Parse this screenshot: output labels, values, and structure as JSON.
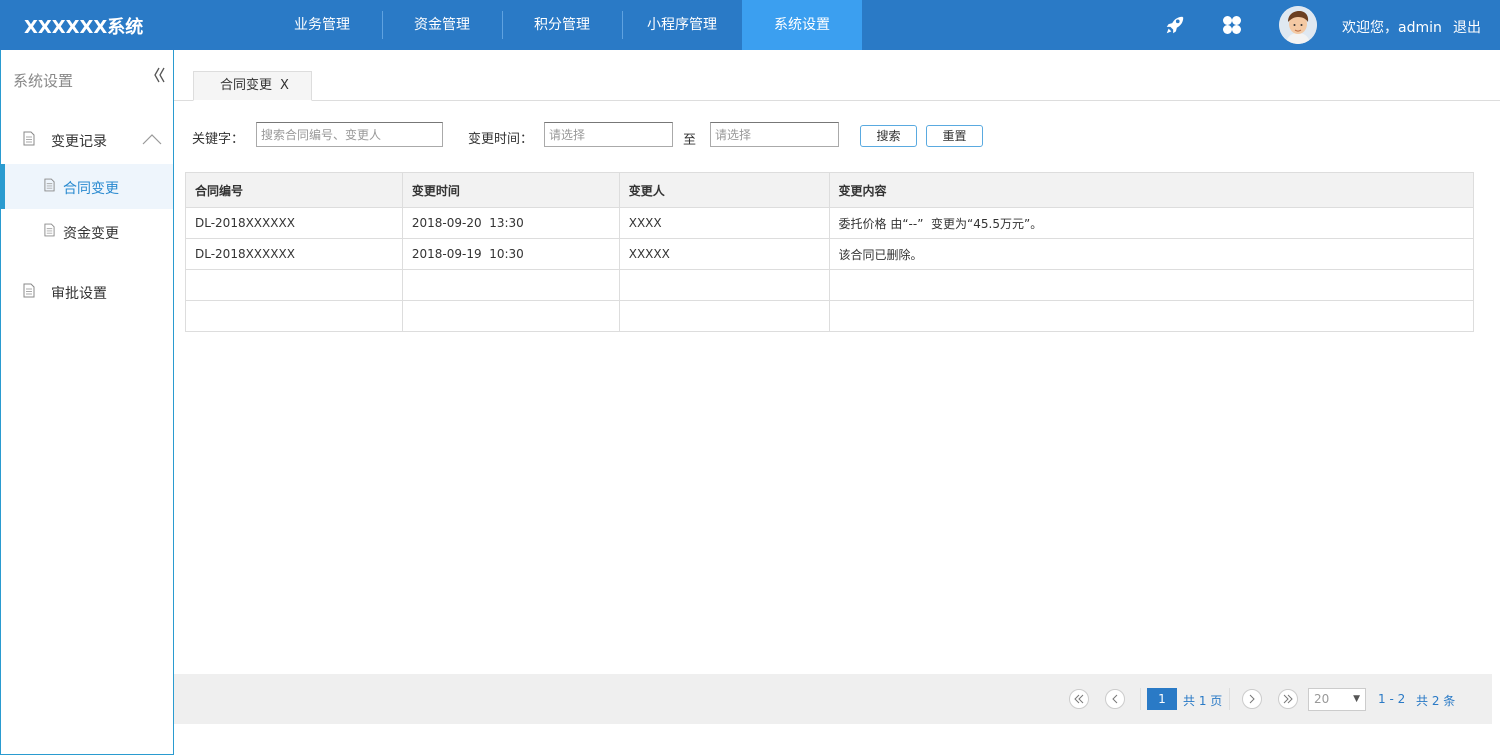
{
  "header": {
    "logo": "XXXXXX系统",
    "nav": [
      "业务管理",
      "资金管理",
      "积分管理",
      "小程序管理",
      "系统设置"
    ],
    "active_nav": 4,
    "welcome": "欢迎您，admin",
    "logout": "退出",
    "icons": [
      "rocket-icon",
      "apps-icon",
      "avatar"
    ]
  },
  "sidebar": {
    "title": "系统设置",
    "collapse_icon": "collapse-icon",
    "groups": [
      {
        "label": "变更记录",
        "expanded": true,
        "items": [
          "合同变更",
          "资金变更"
        ]
      },
      {
        "label": "审批设置"
      }
    ],
    "active_item": "合同变更"
  },
  "tabs": [
    {
      "label": "合同变更",
      "close": "X"
    }
  ],
  "filters": {
    "keyword_label": "关键字：",
    "keyword_placeholder": "搜索合同编号、变更人",
    "time_label": "变更时间：",
    "start_placeholder": "请选择",
    "to_label": "至",
    "end_placeholder": "请选择",
    "search_button": "搜索",
    "reset_button": "重置"
  },
  "table": {
    "columns": [
      "合同编号",
      "变更时间",
      "变更人",
      "变更内容"
    ],
    "rows": [
      [
        "DL-2018XXXXXX",
        "2018-09-20  13:30",
        "XXXX",
        "委托价格 由“--”  变更为“45.5万元”。"
      ],
      [
        "DL-2018XXXXXX",
        "2018-09-19  10:30",
        "XXXXX",
        "该合同已删除。"
      ],
      [
        "",
        "",
        "",
        ""
      ],
      [
        "",
        "",
        "",
        ""
      ]
    ]
  },
  "pager": {
    "current_page": "1",
    "total_pages_text": "共 1 页",
    "page_size": "20",
    "range_text": "1 - 2",
    "total_text": "共 2 条"
  },
  "colors": {
    "header_bg": "#2a7ac6",
    "nav_active": "#3b9ff0",
    "accent": "#2a9bd0"
  }
}
